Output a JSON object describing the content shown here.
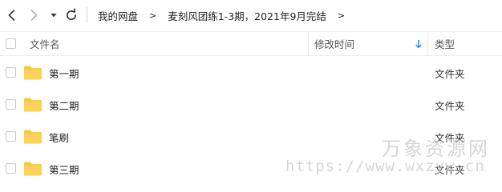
{
  "breadcrumb": {
    "items": [
      "我的网盘",
      "麦刻风团练1-3期，2021年9月完结"
    ],
    "separator": ">"
  },
  "table": {
    "columns": {
      "name": "文件名",
      "modified": "修改时间",
      "type": "类型"
    },
    "sort": {
      "column": "modified",
      "direction": "descending"
    },
    "rows": [
      {
        "name": "第一期",
        "type": "文件夹"
      },
      {
        "name": "第二期",
        "type": "文件夹"
      },
      {
        "name": "笔刷",
        "type": "文件夹"
      },
      {
        "name": "第三期",
        "type": "文件夹"
      }
    ]
  },
  "watermark": {
    "title": "万象资源网",
    "url": "https://www.wxzyw.cn"
  },
  "colors": {
    "folder": "#f7c948",
    "sort_arrow": "#2d8cf0",
    "watermark": "#c9c9c9"
  }
}
